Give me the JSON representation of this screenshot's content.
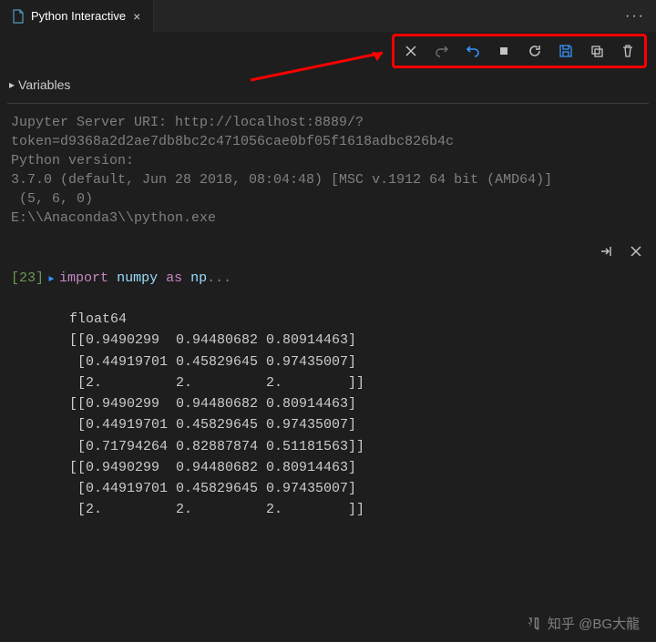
{
  "tab": {
    "label": "Python Interactive",
    "close_glyph": "×"
  },
  "more_glyph": "···",
  "toolbar": {
    "icons": [
      {
        "name": "close-icon"
      },
      {
        "name": "redo-icon"
      },
      {
        "name": "undo-icon"
      },
      {
        "name": "stop-icon"
      },
      {
        "name": "restart-icon"
      },
      {
        "name": "save-icon"
      },
      {
        "name": "copy-icon"
      },
      {
        "name": "trash-icon"
      }
    ]
  },
  "variables": {
    "label": "Variables",
    "chevron": "▸"
  },
  "server_info": "Jupyter Server URI: http://localhost:8889/?\ntoken=d9368a2d2ae7db8bc2c471056cae0bf05f1618adbc826b4c\nPython version:\n3.7.0 (default, Jun 28 2018, 08:04:48) [MSC v.1912 64 bit (AMD64)]\n (5, 6, 0)\nE:\\\\Anaconda3\\\\python.exe",
  "cell": {
    "exec_count": "[23]",
    "prompt_glyph": "▸",
    "code": {
      "kw_import": "import",
      "module": "numpy",
      "kw_as": "as",
      "alias": "np",
      "ellipsis": "..."
    }
  },
  "output": "float64\n[[0.9490299  0.94480682 0.80914463]\n [0.44919701 0.45829645 0.97435007]\n [2.         2.         2.        ]]\n[[0.9490299  0.94480682 0.80914463]\n [0.44919701 0.45829645 0.97435007]\n [0.71794264 0.82887874 0.51181563]]\n[[0.9490299  0.94480682 0.80914463]\n [0.44919701 0.45829645 0.97435007]\n [2.         2.         2.        ]]",
  "watermark": {
    "text": "知乎 @BG大龍"
  }
}
